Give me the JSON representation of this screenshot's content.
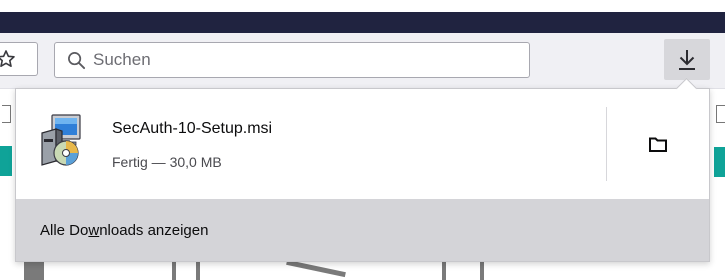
{
  "toolbar": {
    "search": {
      "placeholder": "Suchen"
    }
  },
  "downloads_panel": {
    "items": [
      {
        "file_name": "SecAuth-10-Setup.msi",
        "status": "Fertig — 30,0 MB",
        "icon": "msi-installer-icon"
      }
    ],
    "footer": {
      "label_before": "Alle Do",
      "label_mnemonic": "w",
      "label_after": "nloads anzeigen"
    }
  },
  "colors": {
    "title_bar": "#202340",
    "toolbar_bg": "#f0f0f4",
    "download_button_active": "#d7d7db",
    "panel_footer": "#d4d4d8",
    "teal_accent": "#0fa398"
  }
}
